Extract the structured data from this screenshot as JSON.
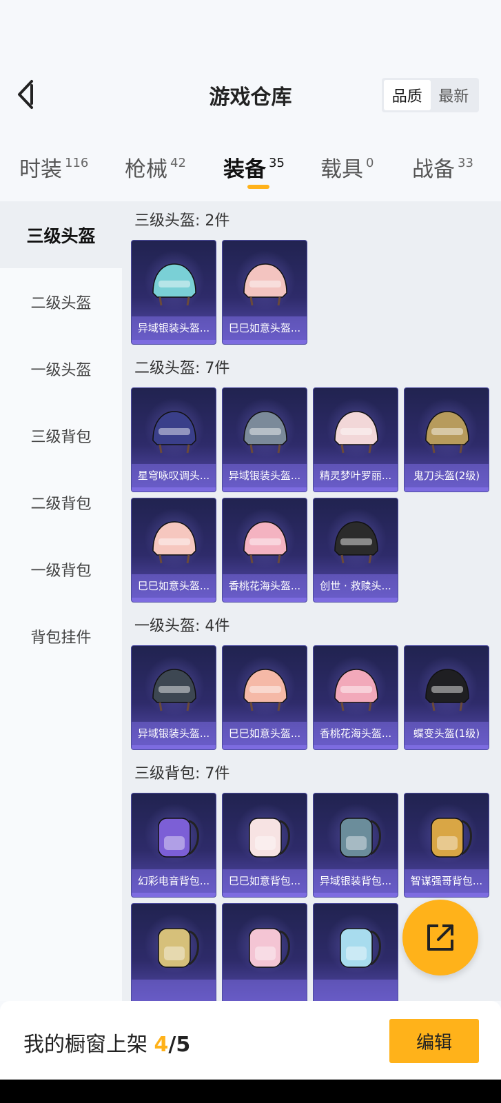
{
  "header": {
    "title": "游戏仓库",
    "sort_options": [
      "品质",
      "最新"
    ],
    "sort_selected": "品质"
  },
  "tabs": [
    {
      "label": "时装",
      "count": "116"
    },
    {
      "label": "枪械",
      "count": "42"
    },
    {
      "label": "装备",
      "count": "35",
      "active": true
    },
    {
      "label": "载具",
      "count": "0"
    },
    {
      "label": "战备",
      "count": "33"
    }
  ],
  "sidebar": [
    {
      "label": "三级头盔",
      "active": true
    },
    {
      "label": "二级头盔"
    },
    {
      "label": "一级头盔"
    },
    {
      "label": "三级背包"
    },
    {
      "label": "二级背包"
    },
    {
      "label": "一级背包"
    },
    {
      "label": "背包挂件"
    }
  ],
  "sections": [
    {
      "title": "三级头盔: 2件",
      "items": [
        {
          "name": "异域银装头盔...",
          "icon": "helmet-icon",
          "color": "#7ad0d6"
        },
        {
          "name": "巳巳如意头盔...",
          "icon": "helmet-icon",
          "color": "#f3c4c0"
        }
      ]
    },
    {
      "title": "二级头盔: 7件",
      "items": [
        {
          "name": "星穹咏叹调头...",
          "icon": "helmet-icon",
          "color": "#3a3f8a"
        },
        {
          "name": "异域银装头盔...",
          "icon": "helmet-icon",
          "color": "#7b8a9a"
        },
        {
          "name": "精灵梦叶罗丽...",
          "icon": "helmet-icon",
          "color": "#f2d7d8"
        },
        {
          "name": "鬼刀头盔(2级)",
          "icon": "helmet-icon",
          "color": "#b79b5c"
        },
        {
          "name": "巳巳如意头盔...",
          "icon": "helmet-icon",
          "color": "#f6c7bf"
        },
        {
          "name": "香桃花海头盔...",
          "icon": "helmet-icon",
          "color": "#f4b3c1"
        },
        {
          "name": "创世 · 救赎头...",
          "icon": "helmet-icon",
          "color": "#2b2b2b"
        }
      ]
    },
    {
      "title": "一级头盔: 4件",
      "items": [
        {
          "name": "异域银装头盔...",
          "icon": "helmet-icon",
          "color": "#3d4752"
        },
        {
          "name": "巳巳如意头盔...",
          "icon": "helmet-icon",
          "color": "#f5b9a7"
        },
        {
          "name": "香桃花海头盔...",
          "icon": "helmet-icon",
          "color": "#f2a9ba"
        },
        {
          "name": "蝶变头盔(1级)",
          "icon": "helmet-icon",
          "color": "#1f1f22"
        }
      ]
    },
    {
      "title": "三级背包: 7件",
      "items": [
        {
          "name": "幻彩电音背包...",
          "icon": "backpack-icon",
          "color": "#7c5fd6"
        },
        {
          "name": "巳巳如意背包...",
          "icon": "backpack-icon",
          "color": "#f7e3e3"
        },
        {
          "name": "异域银装背包...",
          "icon": "backpack-icon",
          "color": "#6b8d9b"
        },
        {
          "name": "智谋强哥背包...",
          "icon": "backpack-icon",
          "color": "#d9a645"
        },
        {
          "name": "",
          "icon": "backpack-icon",
          "color": "#d6c07a"
        },
        {
          "name": "",
          "icon": "backpack-icon",
          "color": "#f4c5d4"
        },
        {
          "name": "",
          "icon": "backpack-icon",
          "color": "#a8dcee"
        }
      ]
    }
  ],
  "footer": {
    "label": "我的橱窗上架 ",
    "current": "4",
    "total": "/5",
    "edit_label": "编辑"
  }
}
